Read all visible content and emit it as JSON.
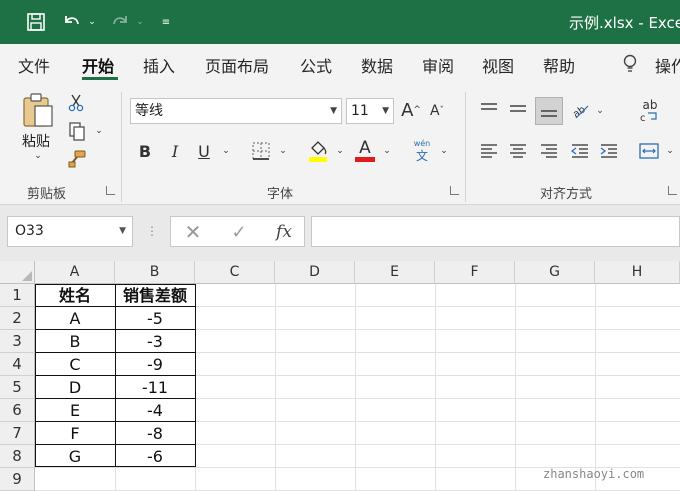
{
  "titlebar": {
    "title": "示例.xlsx  -  Excel",
    "bg": "#1e7145"
  },
  "menu": {
    "tabs": [
      "文件",
      "开始",
      "插入",
      "页面布局",
      "公式",
      "数据",
      "审阅",
      "视图",
      "帮助"
    ],
    "active": "开始",
    "tell_me": "操作"
  },
  "ribbon": {
    "clipboard": {
      "paste_label": "粘贴",
      "group_label": "剪贴板"
    },
    "font": {
      "font_name": "等线",
      "font_size": "11",
      "group_label": "字体",
      "bold": "B",
      "italic": "I",
      "underline": "U",
      "font_color_letter": "A",
      "phonetic_top": "wén",
      "phonetic_bottom": "文",
      "grow_font": "A",
      "shrink_font": "A"
    },
    "alignment": {
      "group_label": "对齐方式",
      "orientation_text": "ab"
    }
  },
  "formula_bar": {
    "name_box": "O33",
    "fx_label": "fx",
    "formula": ""
  },
  "sheet": {
    "columns": [
      "A",
      "B",
      "C",
      "D",
      "E",
      "F",
      "G",
      "H"
    ],
    "rows": [
      "1",
      "2",
      "3",
      "4",
      "5",
      "6",
      "7",
      "8",
      "9"
    ],
    "headers": [
      "姓名",
      "销售差额"
    ],
    "data": [
      [
        "A",
        "-5"
      ],
      [
        "B",
        "-3"
      ],
      [
        "C",
        "-9"
      ],
      [
        "D",
        "-11"
      ],
      [
        "E",
        "-4"
      ],
      [
        "F",
        "-8"
      ],
      [
        "G",
        "-6"
      ]
    ]
  },
  "watermark": "zhanshaoyi.com"
}
